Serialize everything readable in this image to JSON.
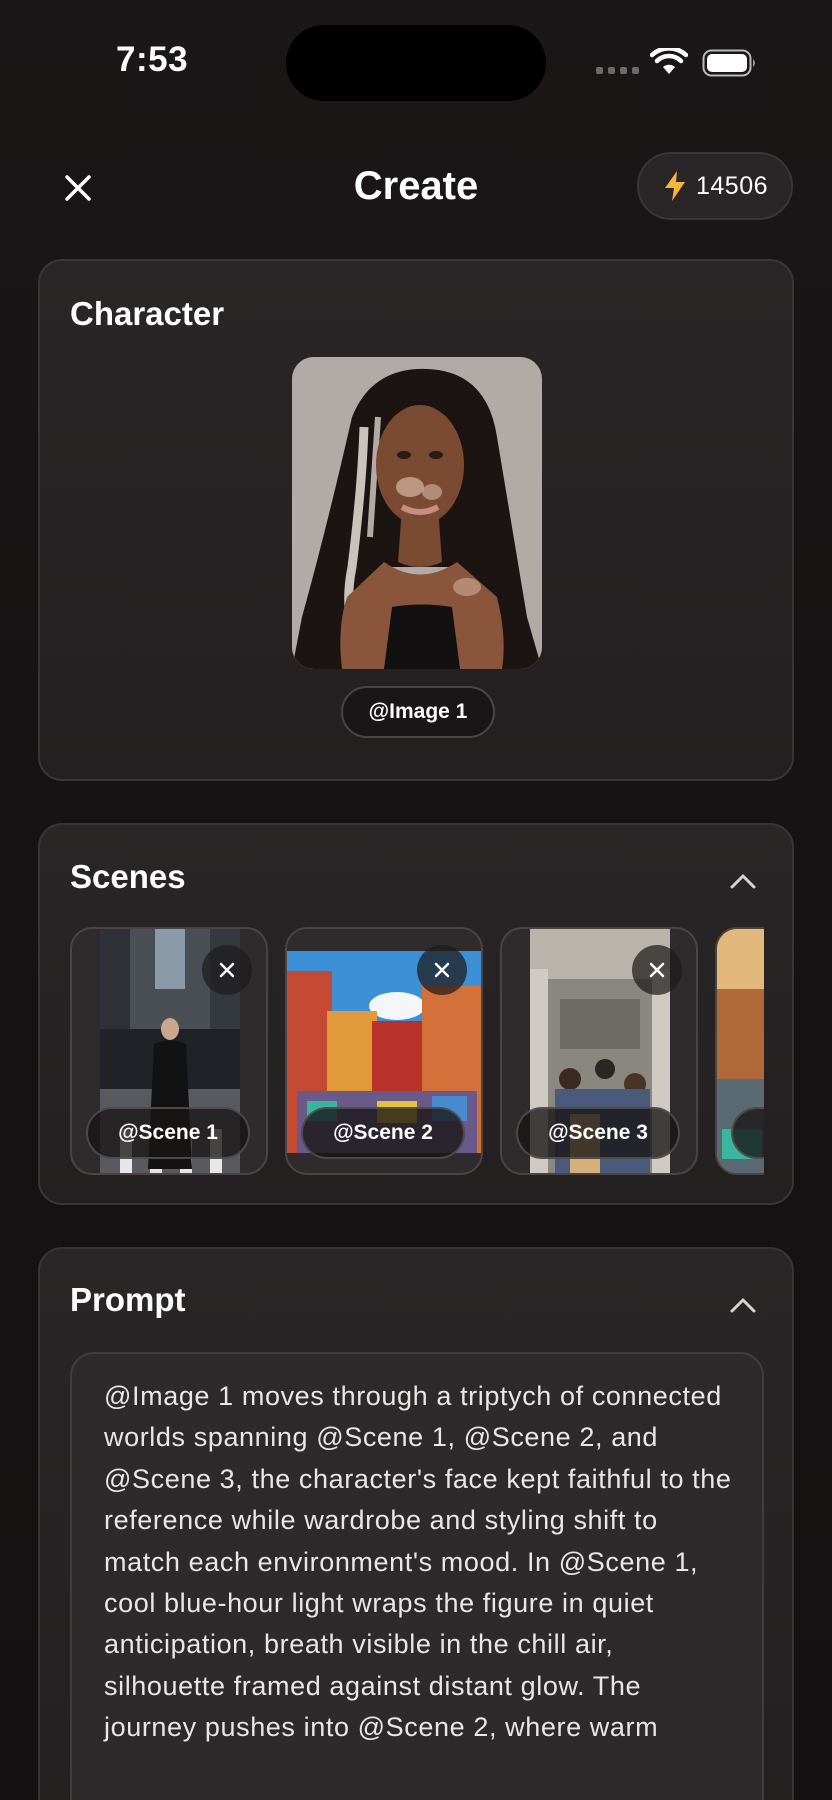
{
  "status_bar": {
    "time": "7:53"
  },
  "header": {
    "title": "Create",
    "credits": "14506"
  },
  "character": {
    "title": "Character",
    "image_label": "@Image 1"
  },
  "scenes": {
    "title": "Scenes",
    "items": [
      {
        "label": "@Scene 1"
      },
      {
        "label": "@Scene 2"
      },
      {
        "label": "@Scene 3"
      },
      {
        "label": "@"
      }
    ]
  },
  "prompt": {
    "title": "Prompt",
    "text": "@Image 1 moves through a triptych of connected worlds spanning @Scene 1, @Scene 2, and @Scene 3, the character's face kept faithful to the reference while wardrobe and styling shift to match each environment's mood. In @Scene 1, cool blue-hour light wraps the figure in quiet anticipation, breath visible in the chill air, silhouette framed against distant glow. The journey pushes into @Scene 2, where warm"
  },
  "colors": {
    "accent_bolt": "#f5b63b",
    "background": "#1a1617",
    "card": "#2a2627"
  }
}
